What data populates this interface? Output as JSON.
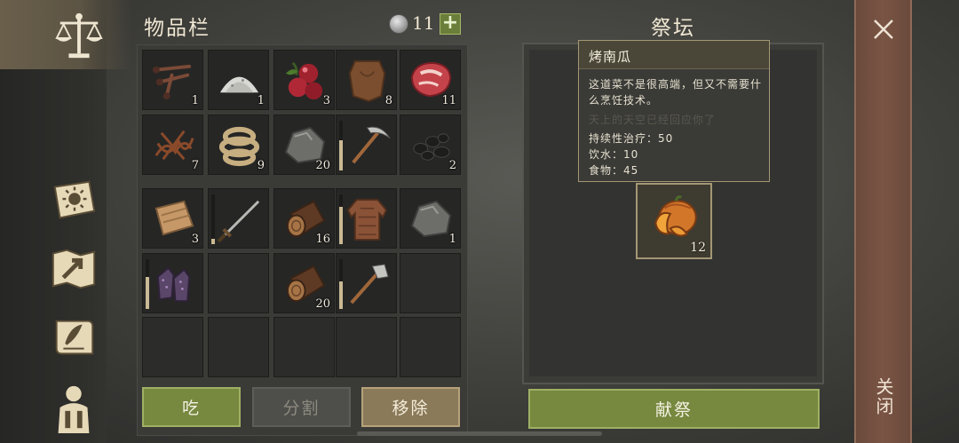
{
  "inventory": {
    "title": "物品栏",
    "coins": "11",
    "plus_label": "+",
    "slots": [
      {
        "icon": "nails-icon",
        "count": "1"
      },
      {
        "icon": "salt-pile-icon",
        "count": "1"
      },
      {
        "icon": "berries-icon",
        "count": "3"
      },
      {
        "icon": "animal-hide-icon",
        "count": "8"
      },
      {
        "icon": "raw-meat-icon",
        "count": "11"
      },
      {
        "icon": "root-bundle-icon",
        "count": "7"
      },
      {
        "icon": "rope-icon",
        "count": "9"
      },
      {
        "icon": "stone-icon",
        "count": "20"
      },
      {
        "icon": "pickaxe-icon",
        "count": "",
        "durability": 0.6
      },
      {
        "icon": "coal-icon",
        "count": "2"
      },
      {
        "icon": "cloth-icon",
        "count": "3"
      },
      {
        "icon": "sword-icon",
        "count": "",
        "durability": 0.1
      },
      {
        "icon": "log-icon",
        "count": "16"
      },
      {
        "icon": "leather-armor-icon",
        "count": "",
        "durability": 0.75
      },
      {
        "icon": "stone-icon",
        "count": "1"
      },
      {
        "icon": "gloves-icon",
        "count": "",
        "durability": 0.65
      },
      {
        "icon": "",
        "count": ""
      },
      {
        "icon": "log-icon",
        "count": "20"
      },
      {
        "icon": "hatchet-icon",
        "count": "",
        "durability": 0.55
      },
      {
        "icon": "",
        "count": ""
      }
    ],
    "buttons": {
      "eat": "吃",
      "split": "分割",
      "remove": "移除"
    }
  },
  "altar": {
    "title": "祭坛",
    "item_count": "12",
    "item_icon": "roasted-pumpkin-icon",
    "offer_button": "献祭"
  },
  "tooltip": {
    "title": "烤南瓜",
    "description": "这道菜不是很高端，但又不需要什么烹饪技术。",
    "faded_text": "天上的天空已经回应你了",
    "stats": [
      "持续性治疗：50",
      "饮水：10",
      "食物：45"
    ]
  },
  "close": {
    "label": "关闭"
  },
  "sidebar": {
    "icons": [
      "balance-scale-icon",
      "sun-book-icon",
      "map-icon",
      "quest-scroll-icon",
      "character-icon"
    ]
  },
  "colors": {
    "accent_green": "#77883f",
    "close_strip": "#7a5444",
    "tooltip_border": "#a39775"
  }
}
